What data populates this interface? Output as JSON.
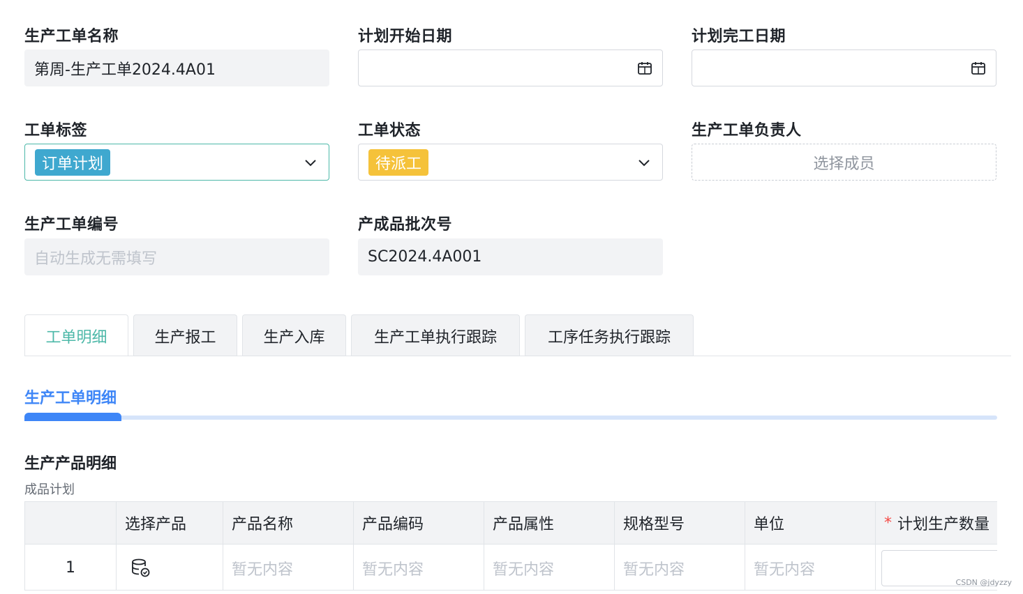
{
  "form": {
    "order_name": {
      "label": "生产工单名称",
      "value": "第周-生产工单2024.4A01"
    },
    "plan_start": {
      "label": "计划开始日期",
      "value": ""
    },
    "plan_end": {
      "label": "计划完工日期",
      "value": ""
    },
    "order_tag": {
      "label": "工单标签",
      "value": "订单计划",
      "color": "#3fa8cf"
    },
    "order_status": {
      "label": "工单状态",
      "value": "待派工",
      "color": "#f5c23a"
    },
    "owner": {
      "label": "生产工单负责人",
      "placeholder": "选择成员"
    },
    "order_no": {
      "label": "生产工单编号",
      "placeholder": "自动生成无需填写"
    },
    "batch_no": {
      "label": "产成品批次号",
      "value": "SC2024.4A001"
    }
  },
  "tabs": [
    "工单明细",
    "生产报工",
    "生产入库",
    "生产工单执行跟踪",
    "工序任务执行跟踪"
  ],
  "active_tab": "工单明细",
  "section": {
    "title": "生产工单明细",
    "progress_fraction": 0.1
  },
  "product_detail": {
    "title": "生产产品明细",
    "caption": "成品计划",
    "columns": [
      "",
      "选择产品",
      "产品名称",
      "产品编码",
      "产品属性",
      "规格型号",
      "单位",
      "计划生产数量"
    ],
    "required_mark": "*",
    "rows": [
      {
        "index": "1",
        "empty_text": "暂无内容"
      }
    ]
  },
  "watermark": "CSDN @jdyzzy",
  "colors": {
    "accent": "#4cb8a8",
    "primary": "#3e86f7",
    "required": "#f54a45"
  }
}
